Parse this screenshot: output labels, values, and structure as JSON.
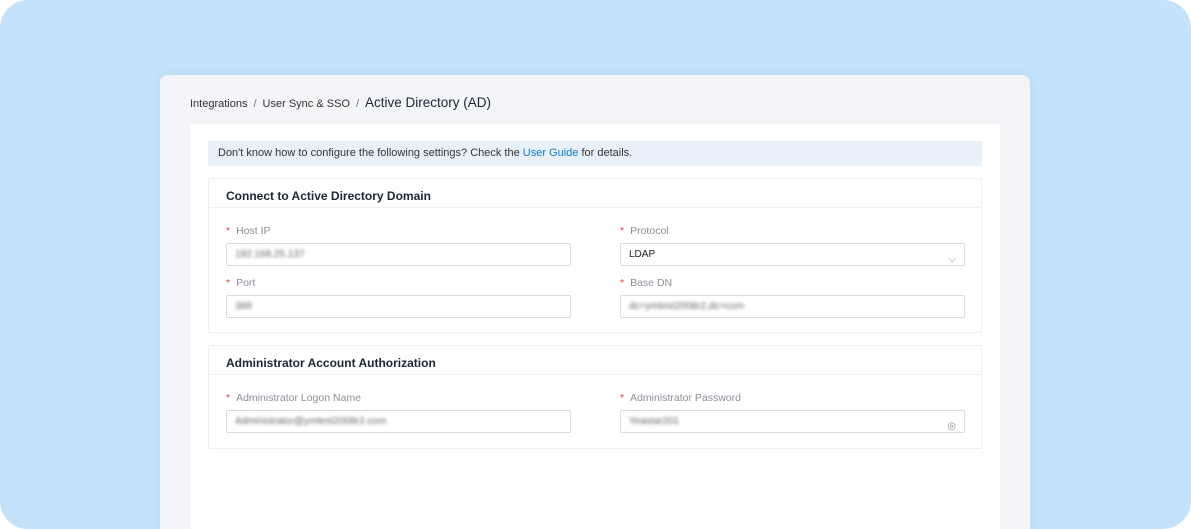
{
  "breadcrumb": {
    "items": [
      "Integrations",
      "User Sync & SSO"
    ],
    "current": "Active Directory (AD)"
  },
  "notice": {
    "before": "Don't know how to configure the following settings? Check the ",
    "link": "User Guide",
    "after": " for details."
  },
  "connect": {
    "title": "Connect to Active Directory Domain",
    "host_ip": {
      "label": "Host IP",
      "value": "192.168.25.137"
    },
    "protocol": {
      "label": "Protocol",
      "value": "LDAP"
    },
    "port": {
      "label": "Port",
      "value": "389"
    },
    "base_dn": {
      "label": "Base DN",
      "value": "dc=ymtest2008r2,dc=com"
    }
  },
  "admin": {
    "title": "Administrator Account Authorization",
    "logon": {
      "label": "Administrator Logon Name",
      "value": "Administrator@ymtest2008r2.com"
    },
    "password": {
      "label": "Administrator Password",
      "value": "Yeastar201"
    }
  },
  "required_mark": "*",
  "colors": {
    "accent": "#1677c9",
    "required": "#e43d3d",
    "background": "#c4e3fb"
  }
}
